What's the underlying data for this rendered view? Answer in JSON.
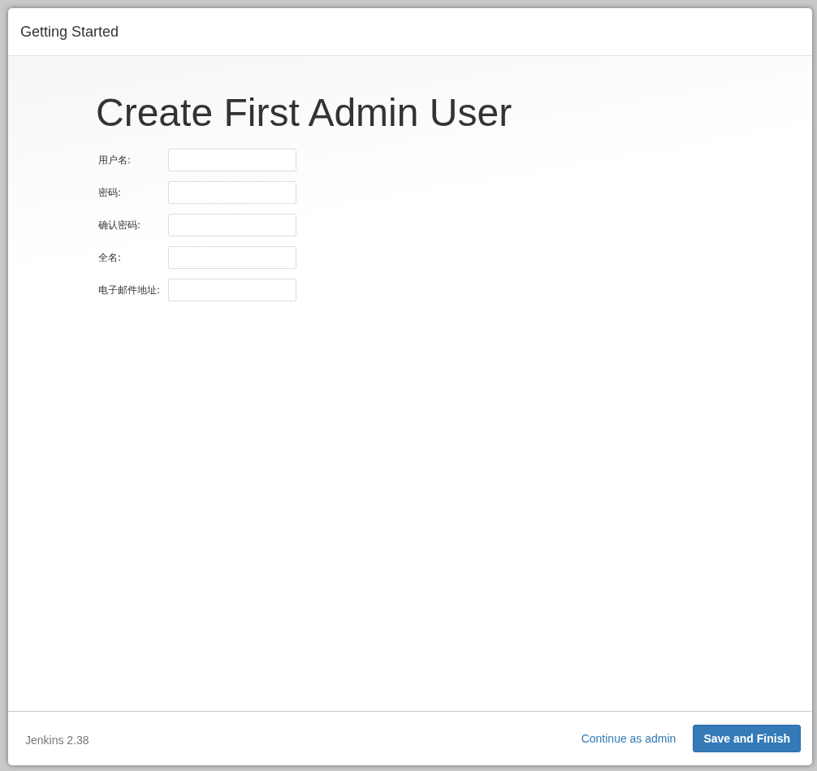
{
  "window": {
    "title": "Getting Started"
  },
  "heading": "Create First Admin User",
  "fields": [
    {
      "label": "用户名:"
    },
    {
      "label": "密码:"
    },
    {
      "label": "确认密码:"
    },
    {
      "label": "全名:"
    },
    {
      "label": "电子邮件地址:"
    }
  ],
  "footer": {
    "version": "Jenkins 2.38",
    "link": "Continue as admin",
    "button": "Save and Finish"
  }
}
